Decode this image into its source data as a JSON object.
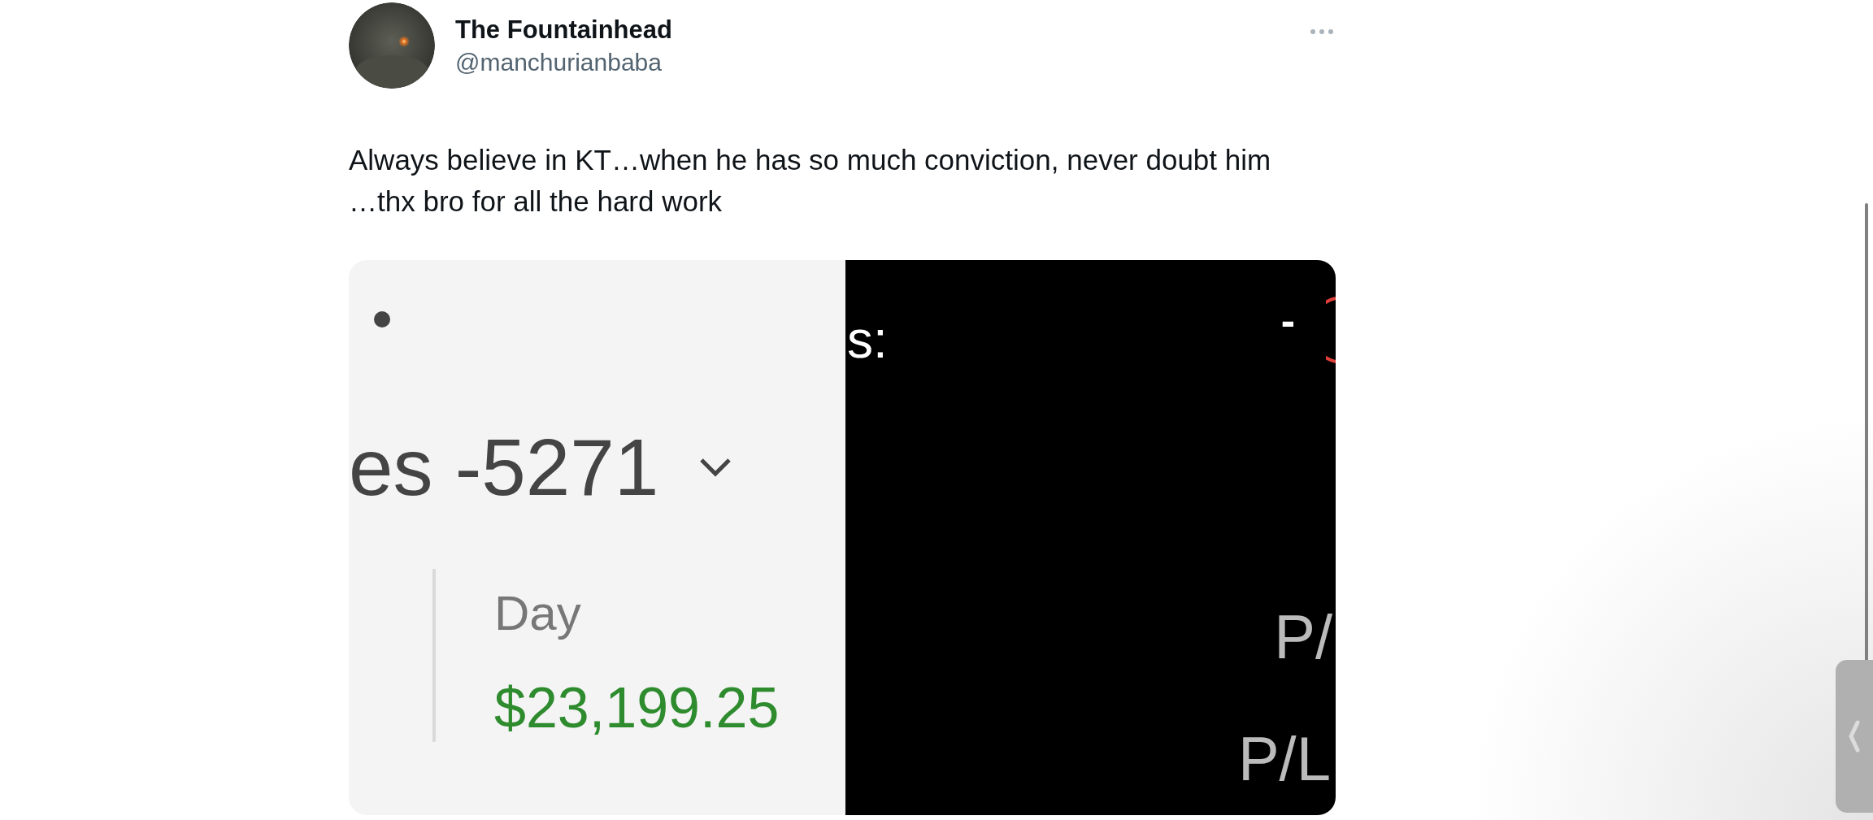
{
  "tweet": {
    "author": {
      "name": "The Fountainhead",
      "handle": "@manchurianbaba"
    },
    "text": "Always believe in KT…when he has so much conviction, never doubt him …thx bro for all the hard work",
    "media": {
      "left_panel": {
        "account": "es -5271",
        "label": "Day",
        "amount": "$23,199.25"
      },
      "right_panel": {
        "heading": "s:",
        "dash": "-",
        "label_1": "P/",
        "label_2": "P/L"
      }
    }
  }
}
